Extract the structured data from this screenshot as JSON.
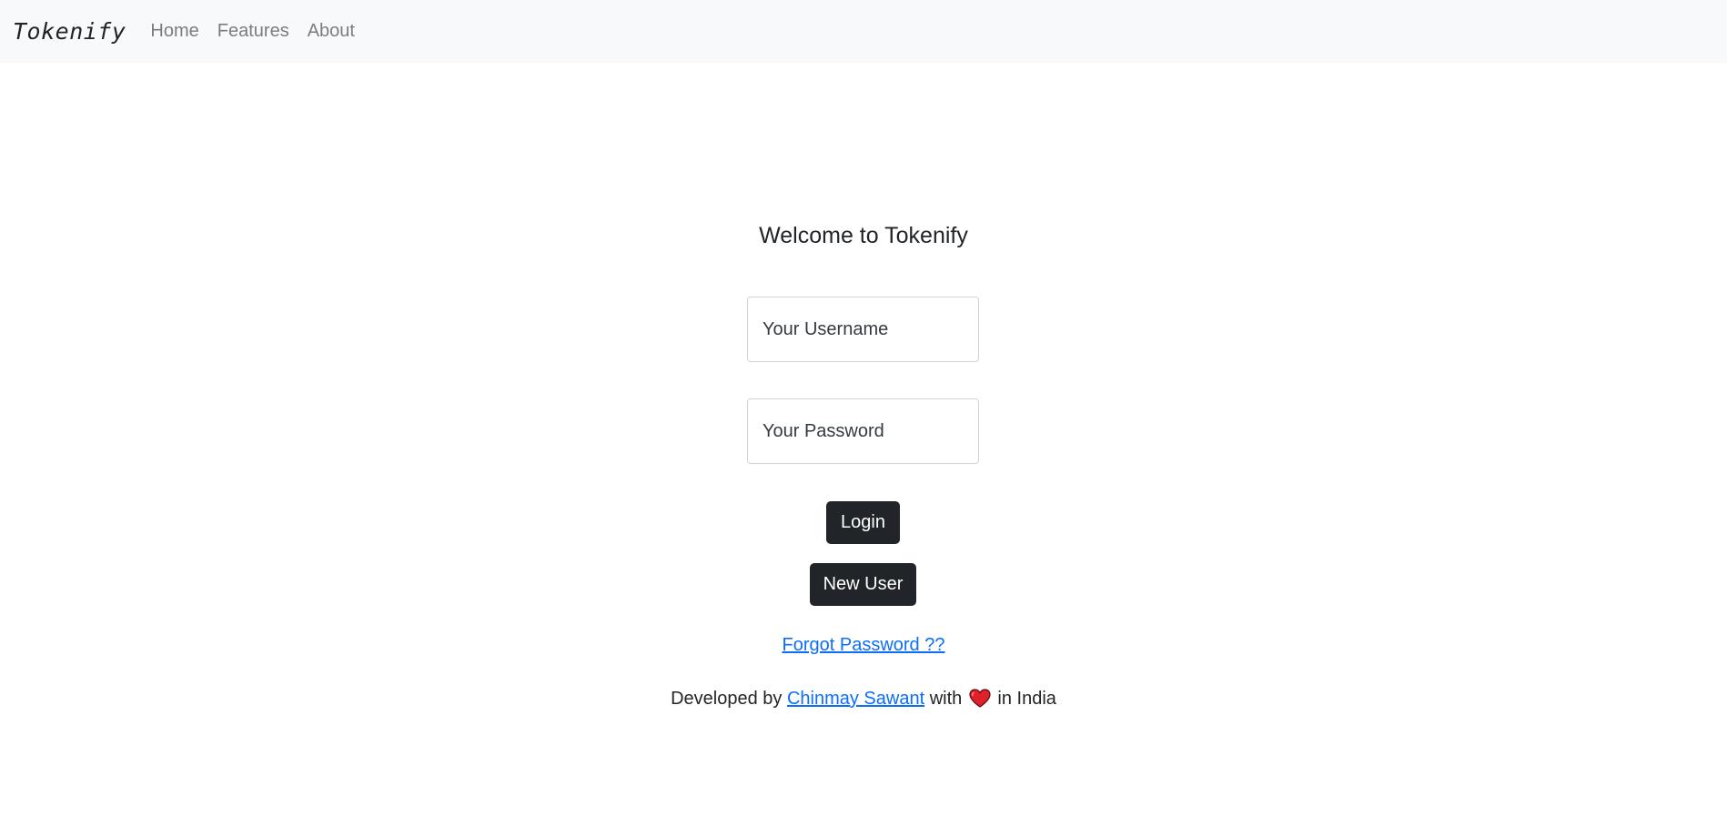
{
  "navbar": {
    "brand": "Tokenify",
    "links": [
      {
        "label": "Home"
      },
      {
        "label": "Features"
      },
      {
        "label": "About"
      }
    ]
  },
  "login": {
    "title": "Welcome to Tokenify",
    "username_placeholder": "Your Username",
    "password_placeholder": "Your Password",
    "login_label": "Login",
    "new_user_label": "New User",
    "forgot_label": "Forgot Password ??"
  },
  "footer": {
    "prefix": "Developed by",
    "author": "Chinmay Sawant",
    "middle": "with",
    "suffix": "in India",
    "heart_icon": "heart-icon",
    "heart_color": "#e0202a"
  }
}
